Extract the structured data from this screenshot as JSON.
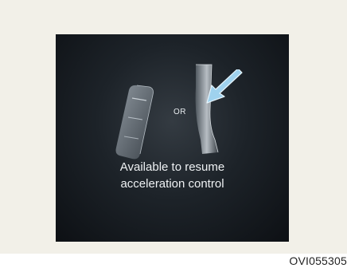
{
  "screen": {
    "or_label": "OR",
    "message_line1": "Available to resume",
    "message_line2": "acceleration control"
  },
  "figure": {
    "code": "OVI055305"
  },
  "icons": {
    "switch": "cruise-control-switch-icon",
    "paddle": "accelerator-pedal-icon",
    "arrow": "arrow-icon"
  },
  "colors": {
    "panel": "#f2f0e8",
    "screen": "#1d2329",
    "arrow": "#9fd2ee",
    "text": "#eef1f3"
  }
}
